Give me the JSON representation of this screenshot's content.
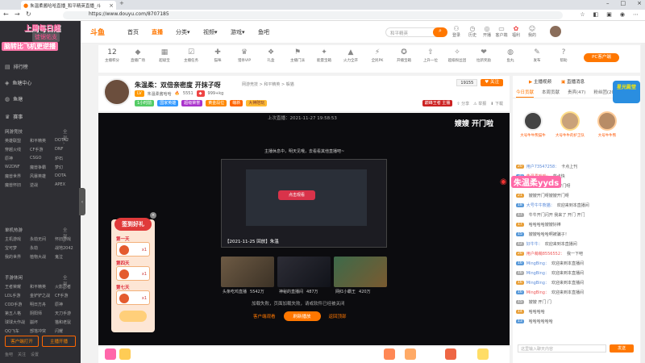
{
  "browser": {
    "tab_title": "朱温柔酱哈哈直播_和平精英直播_斗",
    "url": "https://www.douyu.com/8707185"
  },
  "header": {
    "nav": [
      "首页",
      "直播",
      "分类",
      "视频",
      "游戏",
      "鱼吧"
    ],
    "active_nav": "直播",
    "search_placeholder": "和平精英",
    "icons": [
      "登录",
      "历史",
      "开播",
      "客户端",
      "福利",
      "我的"
    ]
  },
  "promo": {
    "line1": "上周每日超",
    "line2": "徒锯佑支",
    "line3": "脑转比飞机更逆播"
  },
  "sidebar": {
    "top_items": [
      "排行榜",
      "鱼塘中心",
      "鱼塘"
    ],
    "extra": "赛事",
    "cat1_title": "网游竞技",
    "cat1_games": [
      "英雄联盟",
      "和平精英",
      "DOTA2",
      "穿越火线",
      "CF手游",
      "DNF",
      "原神",
      "CSGO",
      "炉石",
      "W2DNF",
      "魔兽争霸",
      "梦幻",
      "魔兽世界",
      "风暴英雄",
      "DOTA",
      "魔兽怀旧",
      "逆战",
      "APEX"
    ],
    "cat2_title": "单机热游",
    "cat2_games": [
      "主机游戏",
      "永劫无间",
      "怀旧游戏",
      "宝可梦",
      "永劫",
      "战地2042",
      "我的世界",
      "植物大战",
      "鬼泣"
    ],
    "cat3_title": "手游休闲",
    "cat3_games": [
      "王者荣耀",
      "和平精英",
      "火影忍者",
      "LOL手游",
      "金铲铲之战",
      "CF手游",
      "COD手游",
      "明日方舟",
      "原神",
      "第五人格",
      "阴阳师",
      "天刀手游",
      "球球大作战",
      "崩坏",
      "猫和老鼠",
      "QQ飞车",
      "部落冲突",
      "闪耀"
    ],
    "buttons": [
      "客户端打开",
      "主播开播"
    ],
    "footer": [
      "鱼吧",
      "关注",
      "设置"
    ]
  },
  "giftbar": {
    "level": "12",
    "items": [
      "主播积分",
      "直播广场",
      "超级宝",
      "主播任务",
      "猫咪",
      "猎杀VIP",
      "礼盒",
      "主播门派",
      "能量宝箱",
      "火力全开",
      "全民PK",
      "开播宝箱",
      "上升一位",
      "超级粉丝团",
      "拉新奖励",
      "鱼丸",
      "发布",
      "帮助"
    ],
    "pc_button": "PC客户端"
  },
  "room": {
    "title": "朱温柔：双倍亲密度 开抹子呀",
    "subtitle": "网游竞技 > 和平精英 > 躲猫",
    "streamer": "朱温柔酱哈哈",
    "level_badge": "LV",
    "hot": "5551",
    "fans": "999+kg",
    "tags": [
      "1小时前",
      "国家英雄",
      "超级荣誉",
      "黄金段位",
      "萌新",
      "大神陪玩"
    ],
    "follow_count": "19155",
    "follow_label": "关注",
    "rank_label": "巅峰王者 主播",
    "share": "分享",
    "report": "举报",
    "download": "下载"
  },
  "video": {
    "top_time": "上次直播：2021-11-27 19:58:53",
    "corner_text": "嫂嫂 开门啦",
    "offline_msg": "主播休息中，明天见哦，去看看其他直播吧~",
    "preview_caption": "【2021-11-25 回放】朱温",
    "play_btn": "点击观看",
    "thumbs": [
      {
        "caption": "头条吃鸡直播",
        "views": "5542万"
      },
      {
        "caption": "神秘的直播间",
        "views": "487万"
      },
      {
        "caption": "网红小霸王",
        "views": "420万"
      }
    ],
    "fail_msg": "加载失败，页面加载失败，请或软件已经被关闭",
    "btn_client": "客户端观看",
    "btn_main": "刷新播放",
    "btn_web": "返回顶部"
  },
  "signin": {
    "title": "签到好礼",
    "days": [
      "第一天",
      "第四天",
      "第七天"
    ],
    "counts": [
      "x1",
      "x1",
      "x1"
    ]
  },
  "rightpanel": {
    "head": [
      "主播视频",
      "直播消息"
    ],
    "tabs": [
      "今日贡献",
      "本周贡献",
      "贵宾(47)",
      "粉丝团(200)"
    ],
    "ranks": [
      {
        "name": "大号牛牛熊猫牛"
      },
      {
        "name": "大号牛牛的护卫队"
      },
      {
        "name": "大号牛牛熊"
      }
    ],
    "chat": [
      {
        "lvl": "20",
        "name": "用户73547258：",
        "text": "卡点上刊"
      },
      {
        "lvl": "30",
        "name": "朱温柔哈哈：",
        "text": "蓝点快"
      },
      {
        "lvl": "19",
        "name": "丁丁我亲：",
        "text": "嫂嫂 开门呀"
      },
      {
        "lvl": "21",
        "name": "",
        "text": "嫂嫂开门呀嫂嫂开门呀"
      },
      {
        "lvl": "18",
        "name": "大号牛牛熊猫：",
        "text": "欢迎来到本直播间"
      },
      {
        "lvl": "17",
        "name": "",
        "text": "牛牛开门闪开 我来了 开门 开门"
      },
      {
        "lvl": "17",
        "name": "",
        "text": "哈哈哈哈嫂嫂好棒"
      },
      {
        "lvl": "15",
        "name": "",
        "text": "嫂嫂哈哈哈啊被骗子！"
      },
      {
        "lvl": "12",
        "name": "好牛牛：",
        "text": "欢迎来到本直播间"
      },
      {
        "lvl": "20",
        "name": "用户萌萌8556552：",
        "text": "我一下吧"
      },
      {
        "lvl": "16",
        "name": "MingBing：",
        "text": "欢迎来到本直播间"
      },
      {
        "lvl": "16",
        "name": "MingBing：",
        "text": "欢迎来到本直播间"
      },
      {
        "lvl": "16",
        "name": "MingBing：",
        "text": "欢迎来到本直播间"
      },
      {
        "lvl": "16",
        "name": "MingBing：",
        "text": "欢迎来到本直播间"
      },
      {
        "lvl": "15",
        "name": "",
        "text": "嫂嫂 开门 门"
      },
      {
        "lvl": "14",
        "name": "",
        "text": "哈哈哈哈"
      },
      {
        "lvl": "13",
        "name": "",
        "text": "哈哈哈哈哈哈"
      }
    ],
    "input_placeholder": "这里输入聊天内容",
    "send": "发送"
  },
  "overlay": {
    "weibo": "朱温柔yyds",
    "float_badge": "星光殿堂"
  },
  "colors": {
    "accent": "#ff7700",
    "sidebar_bg": "#2e2e33",
    "video_bg": "#0c0c0f"
  }
}
